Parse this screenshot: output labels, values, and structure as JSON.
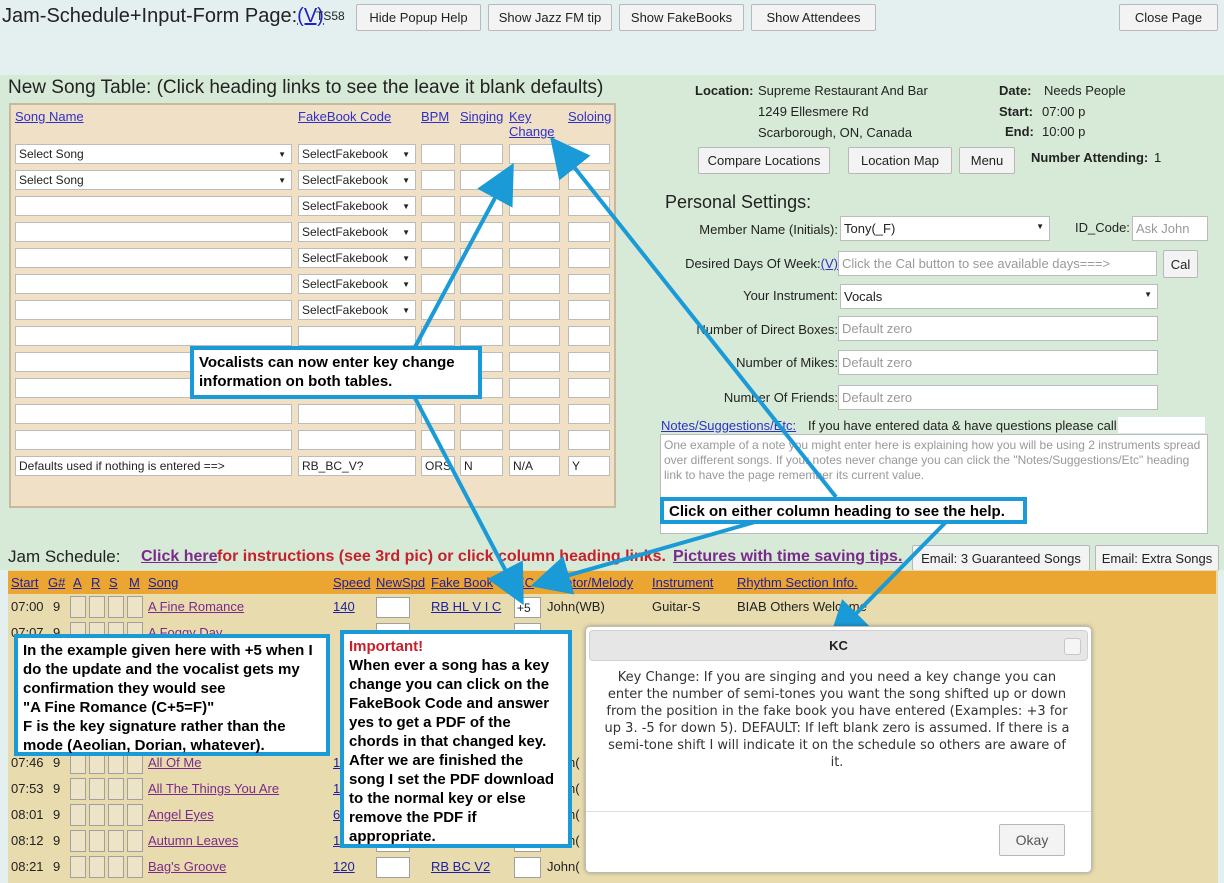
{
  "header": {
    "title": "Jam-Schedule+Input-Form Page:",
    "version_link": "(V)",
    "ts": "TS58",
    "buttons": [
      "Hide Popup Help",
      "Show Jazz FM tip",
      "Show FakeBooks",
      "Show Attendees"
    ],
    "close": "Close Page"
  },
  "new_song": {
    "title": "New Song Table: (Click heading links to see the leave it blank defaults)",
    "headers": [
      "Song Name",
      "FakeBook Code",
      "BPM",
      "Singing",
      "Key\nChange",
      "Soloing"
    ],
    "select_song": "Select Song",
    "select_fakebook": "SelectFakebook",
    "defaults": [
      "Defaults used if nothing is entered ==>",
      "RB_BC_V?",
      "ORS",
      "N",
      "N/A",
      "Y"
    ]
  },
  "location": {
    "label": "Location:",
    "lines": [
      "Supreme Restaurant And Bar",
      "1249 Ellesmere Rd",
      "Scarborough, ON, Canada"
    ],
    "date_label": "Date:",
    "date": "Needs People",
    "start_label": "Start:",
    "start": "07:00 p",
    "end_label": "End:",
    "end": "10:00 p",
    "buttons": [
      "Compare Locations",
      "Location Map",
      "Menu"
    ],
    "attending_label": "Number Attending:",
    "attending": "1"
  },
  "settings": {
    "title": "Personal Settings:",
    "member_label": "Member Name (Initials):",
    "member": "Tony(_F)",
    "id_label": "ID_Code:",
    "id_placeholder": "Ask John",
    "days_label": "Desired Days Of Week:",
    "days_link": "(V)",
    "days_placeholder": "Click the Cal button to see available days===>",
    "cal": "Cal",
    "instrument_label": "Your Instrument:",
    "instrument": "Vocals",
    "boxes_label": "Number of Direct Boxes:",
    "mikes_label": "Number of Mikes:",
    "friends_label": "Number Of Friends:",
    "default_zero": "Default zero",
    "notes_link": "Notes/Suggestions/Etc:",
    "notes_hint": "If you have entered data & have questions please call",
    "notes_text": "One example of a note you might enter here is explaining how you will be using 2 instruments spread over different songs. If your notes never change you can click the \"Notes/Suggestions/Etc\" heading link to have the page remember its current value."
  },
  "jam": {
    "title": "Jam Schedule:",
    "click_here": "Click here",
    "instructions": " for instructions (see 3rd pic) or click column heading links.",
    "pictures": "Pictures with time saving tips.",
    "email1": "Email: 3 Guaranteed Songs",
    "email2": "Email: Extra Songs",
    "headers": [
      "Start",
      "G#",
      "A",
      "R",
      "S",
      "M",
      "Song",
      "Speed",
      "NewSpd",
      "Fake Book",
      "KC",
      "Initiator/Melody",
      "Instrument",
      "Rhythm Section Info."
    ],
    "rows": [
      {
        "start": "07:00",
        "g": "9",
        "song": "A Fine Romance",
        "speed": "140",
        "fb": "RB HL V I C",
        "kc": "+5",
        "init": "John(WB)",
        "inst": "Guitar-S",
        "rhythm": "BIAB Others Welcome"
      },
      {
        "start": "07:07",
        "g": "9",
        "song": "A Foggy Day",
        "speed": "",
        "fb": "",
        "kc": "",
        "init": "",
        "inst": "",
        "rhythm": ""
      },
      {
        "start": "",
        "g": "",
        "song": "",
        "speed": "",
        "fb": "",
        "kc": "",
        "init": "",
        "inst": "",
        "rhythm": ""
      },
      {
        "start": "",
        "g": "",
        "song": "",
        "speed": "",
        "fb": "",
        "kc": "",
        "init": "",
        "inst": "",
        "rhythm": ""
      },
      {
        "start": "",
        "g": "",
        "song": "",
        "speed": "",
        "fb": "",
        "kc": "",
        "init": "",
        "inst": "",
        "rhythm": ""
      },
      {
        "start": "",
        "g": "",
        "song": "",
        "speed": "",
        "fb": "",
        "kc": "",
        "init": "",
        "inst": "",
        "rhythm": ""
      },
      {
        "start": "07:46",
        "g": "9",
        "song": "All Of Me",
        "speed": "1",
        "fb": "",
        "kc": "",
        "init": "John(",
        "inst": "",
        "rhythm": ""
      },
      {
        "start": "07:53",
        "g": "9",
        "song": "All The Things You Are",
        "speed": "1",
        "fb": "",
        "kc": "",
        "init": "John(",
        "inst": "",
        "rhythm": ""
      },
      {
        "start": "08:01",
        "g": "9",
        "song": "Angel Eyes",
        "speed": "6",
        "fb": "",
        "kc": "",
        "init": "John(",
        "inst": "",
        "rhythm": ""
      },
      {
        "start": "08:12",
        "g": "9",
        "song": "Autumn Leaves",
        "speed": "1",
        "fb": "",
        "kc": "",
        "init": "John(",
        "inst": "",
        "rhythm": ""
      },
      {
        "start": "08:21",
        "g": "9",
        "song": "Bag's Groove",
        "speed": "120",
        "fb": "RB BC V2",
        "kc": "",
        "init": "John(",
        "inst": "",
        "rhythm": ""
      }
    ]
  },
  "callouts": {
    "vocalists": "Vocalists can now enter key change information on both tables.",
    "click_either": "Click on either column heading to see the help.",
    "example": "In the example given here with +5 when I do the update and the vocalist gets my confirmation they would see\n \"A Fine Romance (C+5=F)\"\nF is the key signature rather than the mode (Aeolian, Dorian, whatever).",
    "important_title": "Important!",
    "important": "When ever a song has a key change you can click on the FakeBook Code and answer yes to get a PDF of the chords in that changed key. After we are finished the song I set the PDF download to the normal key or else remove the PDF if appropriate."
  },
  "popup": {
    "title": "KC",
    "body": "Key Change: If you are singing and you need a key change you can enter the number of semi-tones you want the song shifted up or down from the position in the fake book you have entered (Examples: +3 for up 3. -5 for down 5). DEFAULT: If left blank zero is assumed. If there is a semi-tone shift I will indicate it on the schedule so others are aware of it.",
    "ok": "Okay"
  },
  "colors": {
    "callout_border": "#1a9ad6",
    "jam_header": "#eba531",
    "link_purple": "#7a2a8a",
    "instr_red": "#c8202a"
  }
}
